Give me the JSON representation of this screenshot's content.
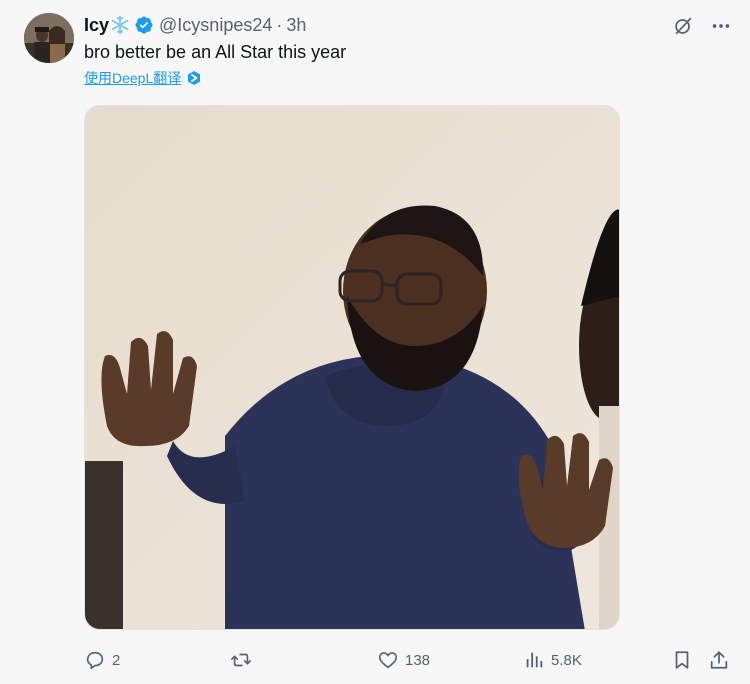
{
  "author": {
    "display_name": "Icy",
    "handle": "@Icysnipes24",
    "separator": "·",
    "time": "3h"
  },
  "tweet": {
    "text": "bro better be an All Star this year",
    "translate_link": "使用DeepL翻译"
  },
  "icons": {
    "name_emoji": "snowflake-icon",
    "verified": "verified-badge-icon",
    "grok": "grok-icon",
    "more": "more-icon",
    "reply": "reply-icon",
    "retweet": "retweet-icon",
    "like": "like-icon",
    "views": "views-icon",
    "bookmark": "bookmark-icon",
    "share": "share-icon"
  },
  "engagement": {
    "replies": "2",
    "retweets": "",
    "likes": "138",
    "views": "5.8K"
  },
  "colors": {
    "accent": "#1d9bf0",
    "text": "#0f1419",
    "muted": "#536471",
    "background": "#f7f7f7"
  }
}
